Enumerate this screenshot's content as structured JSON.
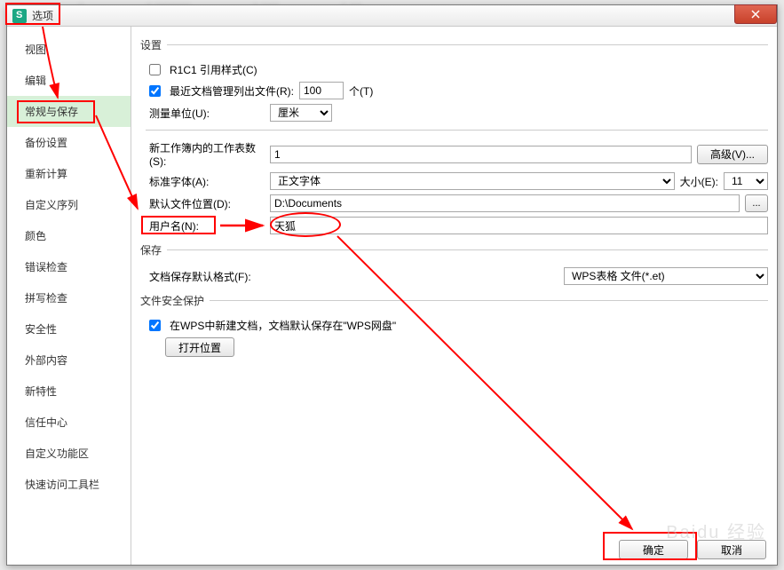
{
  "window": {
    "title": "选项"
  },
  "sidebar": {
    "items": [
      {
        "label": "视图"
      },
      {
        "label": "编辑"
      },
      {
        "label": "常规与保存",
        "selected": true
      },
      {
        "label": "备份设置"
      },
      {
        "label": "重新计算"
      },
      {
        "label": "自定义序列"
      },
      {
        "label": "颜色"
      },
      {
        "label": "错误检查"
      },
      {
        "label": "拼写检查"
      },
      {
        "label": "安全性"
      },
      {
        "label": "外部内容"
      },
      {
        "label": "新特性"
      },
      {
        "label": "信任中心"
      },
      {
        "label": "自定义功能区"
      },
      {
        "label": "快速访问工具栏"
      }
    ]
  },
  "settings": {
    "legend": "设置",
    "r1c1_label": "R1C1 引用样式(C)",
    "r1c1_checked": false,
    "recent_label": "最近文档管理列出文件(R):",
    "recent_checked": true,
    "recent_value": "100",
    "recent_unit": "个(T)",
    "unit_label": "测量单位(U):",
    "unit_value": "厘米"
  },
  "workbook": {
    "sheets_label": "新工作簿内的工作表数(S):",
    "sheets_value": "1",
    "advanced_btn": "高级(V)...",
    "font_label": "标准字体(A):",
    "font_value": "正文字体",
    "size_label": "大小(E):",
    "size_value": "11",
    "path_label": "默认文件位置(D):",
    "path_value": "D:\\Documents",
    "user_label": "用户名(N):",
    "user_value": "天狐"
  },
  "save": {
    "legend": "保存",
    "format_label": "文档保存默认格式(F):",
    "format_value": "WPS表格 文件(*.et)"
  },
  "security": {
    "legend": "文件安全保护",
    "cloud_checked": true,
    "cloud_label": "在WPS中新建文档，文档默认保存在\"WPS网盘\"",
    "open_btn": "打开位置"
  },
  "footer": {
    "ok": "确定",
    "cancel": "取消"
  }
}
